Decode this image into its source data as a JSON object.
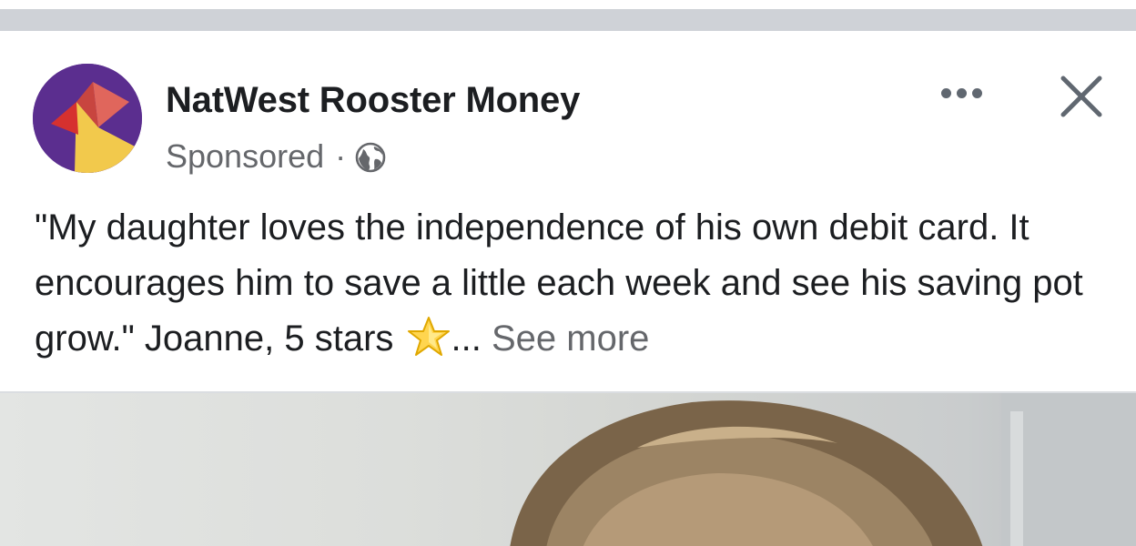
{
  "post": {
    "page_name": "NatWest Rooster Money",
    "sponsored_label": "Sponsored",
    "separator": "·",
    "audience_icon": "globe-icon",
    "more_icon": "more-dots-icon",
    "close_icon": "close-icon",
    "text_main": "\"My daughter loves the independence of his own debit card. It encourages him to save a little each week and see his saving pot grow.\" Joanne, 5 stars ",
    "emoji_icon": "star-emoji-icon",
    "ellipsis": "...",
    "see_more_label": "See more"
  },
  "colors": {
    "avatar_bg": "#5b2e8f",
    "text_primary": "#1c1e21",
    "text_secondary": "#65676b",
    "divider": "#cfd2d7"
  }
}
